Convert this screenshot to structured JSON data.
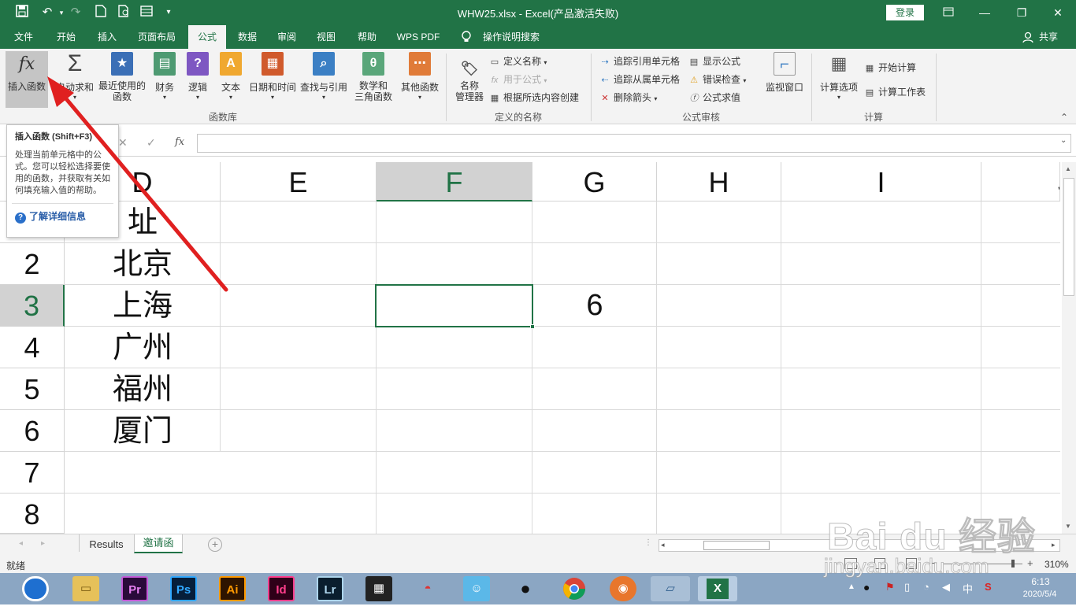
{
  "window": {
    "title": "WHW25.xlsx  -  Excel(产品激活失败)",
    "login": "登录"
  },
  "quick_access": [
    "save-icon",
    "undo-icon",
    "redo-icon",
    "new-file-icon",
    "print-preview-icon",
    "form-icon",
    "customize-icon"
  ],
  "tabs": [
    {
      "label": "文件"
    },
    {
      "label": "开始"
    },
    {
      "label": "插入"
    },
    {
      "label": "页面布局"
    },
    {
      "label": "公式",
      "active": true
    },
    {
      "label": "数据"
    },
    {
      "label": "审阅"
    },
    {
      "label": "视图"
    },
    {
      "label": "帮助"
    },
    {
      "label": "WPS PDF"
    },
    {
      "label": "操作说明搜索"
    }
  ],
  "share": "共享",
  "ribbon": {
    "function_library": {
      "group_label": "函数库",
      "buttons": [
        {
          "label": "插入函数",
          "icon": "fx-icon"
        },
        {
          "label": "自动求和",
          "icon": "sigma-icon"
        },
        {
          "label": "最近使用的\n函数",
          "icon": "star-icon"
        },
        {
          "label": "财务",
          "icon": "finance-icon"
        },
        {
          "label": "逻辑",
          "icon": "logic-icon"
        },
        {
          "label": "文本",
          "icon": "text-icon"
        },
        {
          "label": "日期和时间",
          "icon": "calendar-icon"
        },
        {
          "label": "查找与引用",
          "icon": "lookup-icon"
        },
        {
          "label": "数学和\n三角函数",
          "icon": "math-icon"
        },
        {
          "label": "其他函数",
          "icon": "more-functions-icon"
        }
      ]
    },
    "defined_names": {
      "group_label": "定义的名称",
      "manager": "名称\n管理器",
      "items": [
        "定义名称",
        "用于公式",
        "根据所选内容创建"
      ]
    },
    "formula_auditing": {
      "group_label": "公式审核",
      "col1": [
        "追踪引用单元格",
        "追踪从属单元格",
        "删除箭头"
      ],
      "col2": [
        "显示公式",
        "错误检查",
        "公式求值"
      ],
      "watch": "监视窗口"
    },
    "calculation": {
      "group_label": "计算",
      "options": "计算选项",
      "items": [
        "开始计算",
        "计算工作表"
      ]
    }
  },
  "tooltip": {
    "title": "插入函数 (Shift+F3)",
    "body": "处理当前单元格中的公式。您可以轻松选择要使用的函数，并获取有关如何填充输入值的帮助。",
    "link": "了解详细信息"
  },
  "formula_bar": {
    "fx": "fx",
    "value": ""
  },
  "columns": [
    "D",
    "E",
    "F",
    "G",
    "H",
    "I",
    "J"
  ],
  "selected_column": "F",
  "rows": [
    {
      "num": "1",
      "D": "址"
    },
    {
      "num": "2",
      "D": "北京"
    },
    {
      "num": "3",
      "D": "上海",
      "G": "6"
    },
    {
      "num": "4",
      "D": "广州"
    },
    {
      "num": "5",
      "D": "福州"
    },
    {
      "num": "6",
      "D": "厦门"
    },
    {
      "num": "7",
      "D": ""
    },
    {
      "num": "8",
      "D": ""
    }
  ],
  "selected_row": "3",
  "sheets": [
    {
      "label": "Results"
    },
    {
      "label": "邀请函",
      "active": true
    }
  ],
  "status": {
    "mode": "就绪",
    "zoom": "310%"
  },
  "taskbar": {
    "apps": [
      "Pr",
      "Ps",
      "Ai",
      "Id",
      "Lr"
    ],
    "tray_lang": "中",
    "time": "6:13",
    "date": "2020/5/4"
  },
  "watermark": {
    "logo": "Bai du 经验",
    "url": "jingyan.baidu.com"
  },
  "colors": {
    "excel_green": "#217346",
    "arrow_red": "#e02020"
  }
}
